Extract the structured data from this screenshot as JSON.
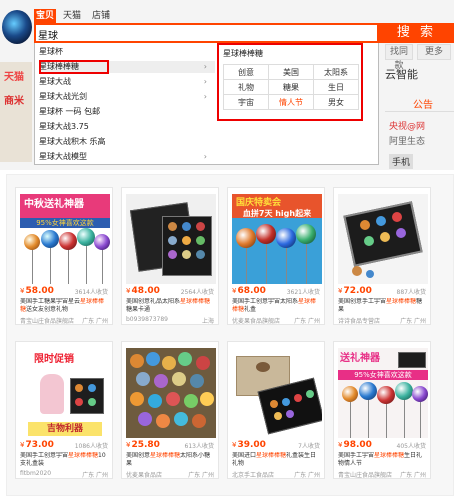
{
  "header": {
    "tabs": [
      {
        "label": "宝贝",
        "active": true
      },
      {
        "label": "天猫",
        "active": false
      },
      {
        "label": "店铺",
        "active": false
      }
    ],
    "search_value": "星球",
    "search_button": "搜 索"
  },
  "suggestions": [
    {
      "label": "星球杯",
      "has_arrow": false
    },
    {
      "label": "星球棒棒糖",
      "has_arrow": true
    },
    {
      "label": "星球大战",
      "has_arrow": true
    },
    {
      "label": "星球大战光剑",
      "has_arrow": true
    },
    {
      "label": "星球杯 一码 包邮",
      "has_arrow": false
    },
    {
      "label": "星球大战3.75",
      "has_arrow": false
    },
    {
      "label": "星球大战积木 乐高",
      "has_arrow": false
    },
    {
      "label": "星球大战模型",
      "has_arrow": true
    }
  ],
  "sub_panel": {
    "title": "星球棒棒糖",
    "rows": [
      [
        "创意",
        "美国",
        "太阳系"
      ],
      [
        "礼物",
        "糖果",
        "生日"
      ],
      [
        "宇宙",
        "情人节",
        "男女"
      ]
    ],
    "hot": "情人节"
  },
  "background": {
    "right_buttons": [
      "找同款",
      "更多"
    ],
    "nav_label": "云智能",
    "notice_tab": "公告",
    "notice_lines": [
      "央视@网",
      "阿里生态",
      "手机"
    ],
    "left_banner": [
      "天猫",
      "商米"
    ]
  },
  "products": [
    {
      "price": "58.00",
      "sold": "3614人收货",
      "title_pre": "美国手工糖果宇宙星云",
      "title_kw": "星球棒棒糖",
      "title_post": "送女友创意礼物",
      "shop": "青宝山庄食品旗舰店",
      "location": "广东 广州",
      "banner": "中秋送礼神器",
      "banner_sub": "95%女神喜欢这款"
    },
    {
      "price": "48.00",
      "sold": "2564人收货",
      "title_pre": "美国创意礼品太阳系",
      "title_kw": "星球棒棒糖",
      "title_post": "糖果卡通",
      "shop": "b0939873789",
      "location": "上海",
      "banner": "",
      "banner_sub": ""
    },
    {
      "price": "68.00",
      "sold": "3621人收货",
      "title_pre": "美国手工创意宇宙太阳系",
      "title_kw": "星球棒棒糖",
      "title_post": "礼盒",
      "shop": "优麦果食品旗舰店",
      "location": "广东 广州",
      "banner": "国庆特卖会",
      "banner_sub": "血拼7天 high起来"
    },
    {
      "price": "72.00",
      "sold": "887人收货",
      "title_pre": "美国创意手工宇宙",
      "title_kw": "星球棒棒糖",
      "title_post": "糖果",
      "shop": "诗诗食品专营店",
      "location": "广东 广州",
      "banner": "",
      "banner_sub": ""
    },
    {
      "price": "73.00",
      "sold": "1086人收货",
      "title_pre": "美国手工创意宇宙",
      "title_kw": "星球棒棒糖",
      "title_post": "10支礼盒装",
      "shop": "fitbm2020",
      "location": "广东 广州",
      "banner": "限时促销",
      "banner_sub": "吉物利器"
    },
    {
      "price": "25.80",
      "sold": "613人收货",
      "title_pre": "美国创意",
      "title_kw": "星球棒棒糖",
      "title_post": "太阳系小糖果",
      "shop": "优麦果食品店",
      "location": "广东 广州",
      "banner": "",
      "banner_sub": ""
    },
    {
      "price": "39.00",
      "sold": "7人收货",
      "title_pre": "美国进口",
      "title_kw": "星球棒棒糖",
      "title_post": "礼盒装生日礼物",
      "shop": "北京手工食品店",
      "location": "广东 广州",
      "banner": "",
      "banner_sub": ""
    },
    {
      "price": "98.00",
      "sold": "405人收货",
      "title_pre": "美国手工宇宙",
      "title_kw": "星球棒棒糖",
      "title_post": "生日礼物情人节",
      "shop": "青宝山庄食品旗舰店",
      "location": "广东 广州",
      "banner": "送礼神器",
      "banner_sub": "95%女神喜欢这款"
    }
  ],
  "colors": {
    "accent": "#ff4400",
    "highlight_border": "#e00000"
  }
}
